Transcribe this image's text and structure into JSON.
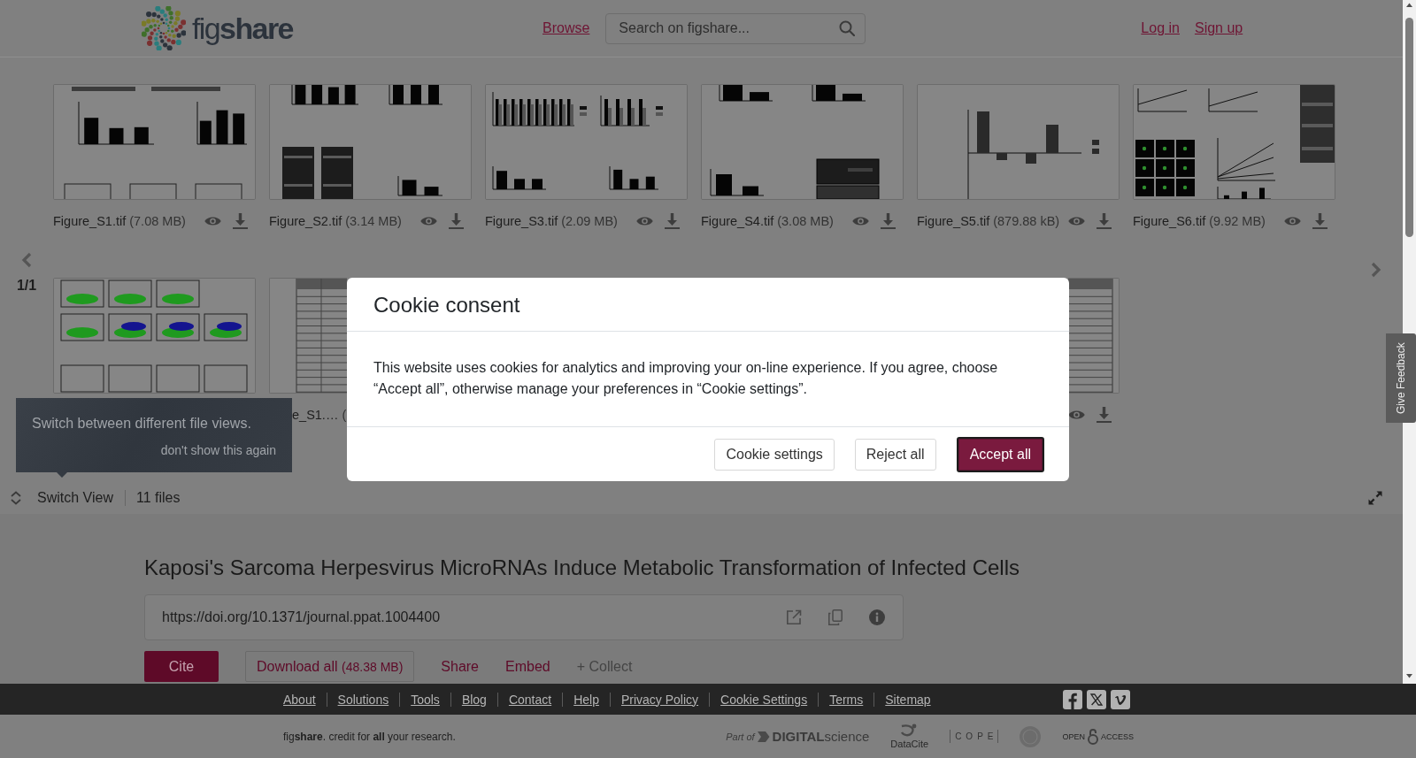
{
  "header": {
    "logo": "fig**share**",
    "nav": [
      {
        "label": "Browse"
      }
    ],
    "search": {
      "placeholder": "Search on figshare..."
    },
    "account_links": [
      {
        "label": "Log in"
      },
      {
        "label": "Sign up"
      }
    ]
  },
  "file_viewer": {
    "page_indicator": "1/1",
    "rows": [
      [
        {
          "kind": "bar-charts",
          "name": "Figure_S1.tif",
          "size": "(7.08 MB)",
          "actions": [
            {
              "kind": "preview"
            },
            {
              "kind": "download"
            }
          ]
        },
        {
          "kind": "blot-panels",
          "name": "Figure_S2.tif",
          "size": "(3.14 MB)",
          "actions": [
            {
              "kind": "preview"
            },
            {
              "kind": "download"
            }
          ]
        },
        {
          "kind": "grouped-bars",
          "name": "Figure_S3.tif",
          "size": "(2.09 MB)",
          "actions": [
            {
              "kind": "preview"
            },
            {
              "kind": "download"
            }
          ]
        },
        {
          "kind": "bars-blot",
          "name": "Figure_S4.tif",
          "size": "(3.08 MB)",
          "actions": [
            {
              "kind": "preview"
            },
            {
              "kind": "download"
            }
          ]
        },
        {
          "kind": "log-bars",
          "name": "Figure_S5.tif",
          "size": "(879.88 kB)",
          "actions": [
            {
              "kind": "preview"
            },
            {
              "kind": "download"
            }
          ]
        },
        {
          "kind": "growth-curves",
          "name": "Figure_S6.tif",
          "size": "(9.92 MB)",
          "actions": [
            {
              "kind": "preview"
            },
            {
              "kind": "download"
            }
          ]
        }
      ],
      [
        {
          "kind": "flow-cytometry"
        },
        {
          "kind": "table",
          "name": "e_S1.…",
          "size": "("
        },
        {
          "kind": "table",
          "actions": [
            {
              "kind": "preview"
            },
            {
              "kind": "download"
            }
          ]
        }
      ]
    ],
    "hint": {
      "text": "Switch between different file views.",
      "dismiss": "don't show this again"
    },
    "switch_view": "Switch View",
    "file_count": "11 files"
  },
  "article": {
    "title": "Kaposi's Sarcoma Herpesvirus MicroRNAs Induce Metabolic Transformation of Infected Cells",
    "doi": "https://doi.org/10.1371/journal.ppat.1004400",
    "doi_actions": [
      {
        "kind": "external-link"
      },
      {
        "kind": "copy"
      },
      {
        "kind": "info"
      }
    ],
    "actions": [
      {
        "kind": "primary",
        "label": "Cite"
      },
      {
        "kind": "outline",
        "label": "Download all",
        "note": "(48.38 MB)"
      },
      {
        "kind": "link",
        "label": "Share"
      },
      {
        "kind": "link",
        "label": "Embed"
      },
      {
        "kind": "muted",
        "label": "+ Collect"
      }
    ]
  },
  "feedback_tab": "Give Feedback",
  "cookie_dialog": {
    "title": "Cookie consent",
    "message": "This website uses cookies for analytics and improving your on-line experience. If you agree, choose “Accept all”, otherwise manage your preferences in “Cookie settings”.",
    "buttons": [
      {
        "kind": "secondary",
        "label": "Cookie settings",
        "focused": false
      },
      {
        "kind": "secondary",
        "label": "Reject all",
        "focused": false
      },
      {
        "kind": "primary",
        "label": "Accept all",
        "focused": true
      }
    ]
  },
  "footer": {
    "links": [
      "About",
      "Solutions",
      "Tools",
      "Blog",
      "Contact",
      "Help",
      "Privacy Policy",
      "Cookie Settings",
      "Terms",
      "Sitemap"
    ],
    "social": [
      {
        "kind": "facebook"
      },
      {
        "kind": "x"
      },
      {
        "kind": "vimeo"
      }
    ],
    "tagline": "fig**share**. credit for **all** your research.",
    "partners": [
      {
        "kind": "digital-science",
        "before": "Part of",
        "after": "**DIGITAL**science"
      },
      {
        "kind": "datacite",
        "after": "DataCite"
      },
      {
        "kind": "cope",
        "after": "COPE"
      },
      {
        "kind": "seal"
      },
      {
        "kind": "open-access",
        "before": "OPEN",
        "after": "ACCESS"
      }
    ]
  }
}
